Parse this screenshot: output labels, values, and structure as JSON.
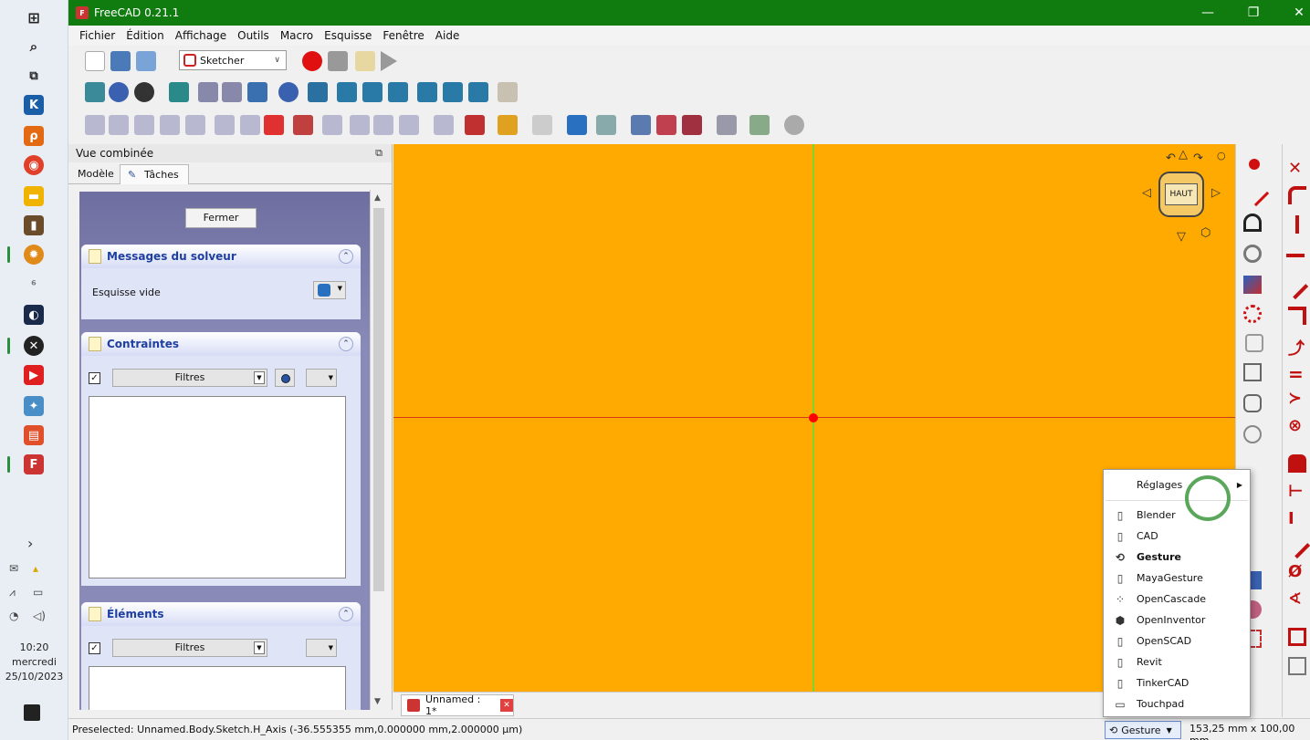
{
  "window": {
    "title": "FreeCAD 0.21.1",
    "minimize": "—",
    "maximize": "❐",
    "close": "✕"
  },
  "menu": [
    "Fichier",
    "Édition",
    "Affichage",
    "Outils",
    "Macro",
    "Esquisse",
    "Fenêtre",
    "Aide"
  ],
  "workbench": {
    "selected": "Sketcher"
  },
  "combo_view": {
    "title": "Vue combinée",
    "tabs": [
      "Modèle",
      "Tâches"
    ],
    "close_button": "Fermer",
    "solver_panel": {
      "title": "Messages du solveur",
      "message": "Esquisse vide"
    },
    "constraints_panel": {
      "title": "Contraintes",
      "filter": "Filtres"
    },
    "elements_panel": {
      "title": "Éléments",
      "filter": "Filtres"
    }
  },
  "view3d": {
    "background": "#ffaa00",
    "navcube_face": "HAUT"
  },
  "document_tab": {
    "label": "Unnamed : 1*"
  },
  "status": {
    "preselected": "Preselected: Unnamed.Body.Sketch.H_Axis (-36.555355 mm,0.000000 mm,2.000000 µm)",
    "navigation_style": "Gesture",
    "dimensions": "153,25 mm x 100,00 mm"
  },
  "context_menu": {
    "submenu": "Réglages",
    "items": [
      {
        "label": "Blender",
        "icon": "mouse-icon"
      },
      {
        "label": "CAD",
        "icon": "mouse-icon"
      },
      {
        "label": "Gesture",
        "icon": "gesture-icon",
        "selected": true
      },
      {
        "label": "MayaGesture",
        "icon": "mouse-icon"
      },
      {
        "label": "OpenCascade",
        "icon": "opencascade-icon"
      },
      {
        "label": "OpenInventor",
        "icon": "openinventor-icon"
      },
      {
        "label": "OpenSCAD",
        "icon": "mouse-icon"
      },
      {
        "label": "Revit",
        "icon": "mouse-icon"
      },
      {
        "label": "TinkerCAD",
        "icon": "mouse-icon"
      },
      {
        "label": "Touchpad",
        "icon": "touchpad-icon"
      }
    ]
  },
  "taskbar": {
    "time": "10:20",
    "day": "mercredi",
    "date": "25/10/2023"
  }
}
